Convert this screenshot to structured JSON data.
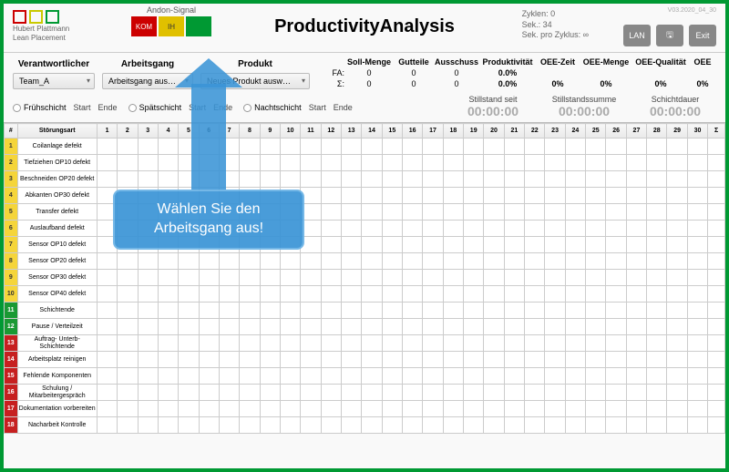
{
  "header": {
    "brand_line1": "Hubert Plattmann",
    "brand_line2": "Lean Placement",
    "andon_label": "Andon-Signal",
    "andon_kom": "KOM",
    "andon_ih": "IH",
    "title": "ProductivityAnalysis",
    "stats_zyklen": "Zyklen: 0",
    "stats_sek": "Sek.: 34",
    "stats_spz": "Sek. pro Zyklus: ∞",
    "version": "V03.2020_04_30",
    "btn_lan": "LAN",
    "btn_save": "🖫",
    "btn_exit": "Exit"
  },
  "selectors": {
    "verantwortlicher_label": "Verantwortlicher",
    "verantwortlicher_value": "Team_A",
    "arbeitsgang_label": "Arbeitsgang",
    "arbeitsgang_value": "Arbeitsgang auswä…",
    "produkt_label": "Produkt",
    "produkt_value": "Neues Produkt auswählen!"
  },
  "kpi": {
    "hdr_soll": "Soll-Menge",
    "hdr_gut": "Gutteile",
    "hdr_aus": "Ausschuss",
    "hdr_prod": "Produktivität",
    "hdr_ozeit": "OEE-Zeit",
    "hdr_omenge": "OEE-Menge",
    "hdr_oqual": "OEE-Qualität",
    "hdr_oee": "OEE",
    "label_fa": "FA:",
    "label_sigma": "Σ:",
    "fa": {
      "soll": "0",
      "gut": "0",
      "aus": "0",
      "prod": "0.0%"
    },
    "sigma": {
      "soll": "0",
      "gut": "0",
      "aus": "0",
      "prod": "0.0%",
      "ozeit": "0%",
      "omenge": "0%",
      "oqual": "0%",
      "oee": "0%"
    }
  },
  "shifts": {
    "frueh": "Frühschicht",
    "spaet": "Spätschicht",
    "nacht": "Nachtschicht",
    "start": "Start",
    "ende": "Ende",
    "t1_label": "Stillstand seit",
    "t1_val": "00:00:00",
    "t2_label": "Stillstandssumme",
    "t2_val": "00:00:00",
    "t3_label": "Schichtdauer",
    "t3_val": "00:00:00"
  },
  "grid": {
    "col_idx": "#",
    "col_name": "Störungsart",
    "col_sum": "Σ",
    "rows": [
      {
        "c": "yel",
        "n": "1",
        "name": "Coilanlage defekt"
      },
      {
        "c": "yel",
        "n": "2",
        "name": "Tiefziehen OP10 defekt"
      },
      {
        "c": "yel",
        "n": "3",
        "name": "Beschneiden OP20 defekt"
      },
      {
        "c": "yel",
        "n": "4",
        "name": "Abkanten OP30 defekt"
      },
      {
        "c": "yel",
        "n": "5",
        "name": "Transfer defekt"
      },
      {
        "c": "yel",
        "n": "6",
        "name": "Auslaufband defekt"
      },
      {
        "c": "yel",
        "n": "7",
        "name": "Sensor OP10 defekt"
      },
      {
        "c": "yel",
        "n": "8",
        "name": "Sensor OP20 defekt"
      },
      {
        "c": "yel",
        "n": "9",
        "name": "Sensor OP30 defekt"
      },
      {
        "c": "yel",
        "n": "10",
        "name": "Sensor OP40 defekt"
      },
      {
        "c": "grn",
        "n": "11",
        "name": "Schichtende"
      },
      {
        "c": "grn",
        "n": "12",
        "name": "Pause / Verteilzeit"
      },
      {
        "c": "red",
        "n": "13",
        "name": "Auftrag- Unterb- Schichtende"
      },
      {
        "c": "red",
        "n": "14",
        "name": "Arbeitsplatz reinigen"
      },
      {
        "c": "red",
        "n": "15",
        "name": "Fehlende Komponenten"
      },
      {
        "c": "red",
        "n": "16",
        "name": "Schulung / Mitarbeitergespräch"
      },
      {
        "c": "red",
        "n": "17",
        "name": "Dokumentation vorbereiten"
      },
      {
        "c": "red",
        "n": "18",
        "name": "Nacharbeit Kontrolle"
      }
    ]
  },
  "callout": "Wählen Sie den Arbeitsgang aus!"
}
